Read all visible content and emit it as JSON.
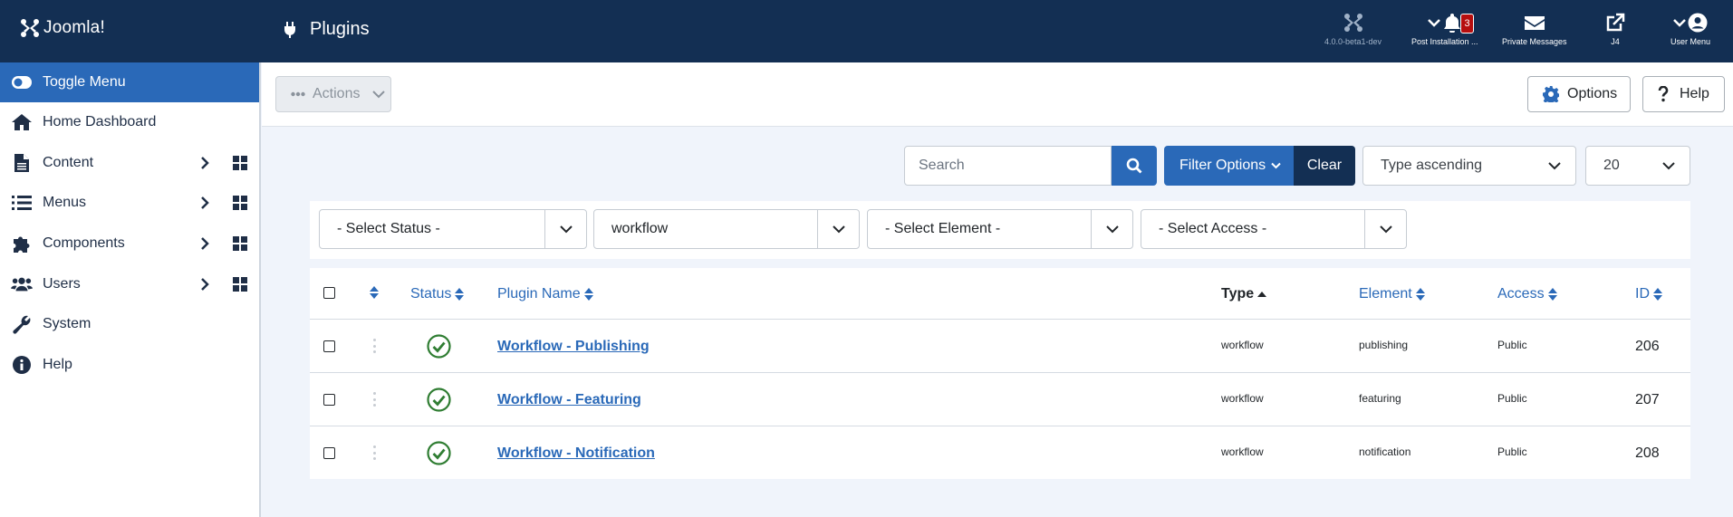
{
  "header": {
    "logo_text": "Joomla!",
    "title": "Plugins",
    "items": [
      {
        "label": "4.0.0-beta1-dev",
        "icon": "joomla-icon"
      },
      {
        "label": "Post Installation ...",
        "icon": "bell-icon",
        "badge": "3"
      },
      {
        "label": "Private Messages",
        "icon": "envelope-icon"
      },
      {
        "label": "J4",
        "icon": "external-link-icon"
      },
      {
        "label": "User Menu",
        "icon": "user-icon"
      }
    ]
  },
  "sidebar": {
    "items": [
      {
        "label": "Toggle Menu",
        "icon": "toggle-icon",
        "active": true
      },
      {
        "label": "Home Dashboard",
        "icon": "home-icon"
      },
      {
        "label": "Content",
        "icon": "file-icon",
        "submenu": true
      },
      {
        "label": "Menus",
        "icon": "list-icon",
        "submenu": true
      },
      {
        "label": "Components",
        "icon": "puzzle-icon",
        "submenu": true
      },
      {
        "label": "Users",
        "icon": "users-icon",
        "submenu": true
      },
      {
        "label": "System",
        "icon": "wrench-icon"
      },
      {
        "label": "Help",
        "icon": "info-icon"
      }
    ]
  },
  "toolbar": {
    "actions_label": "Actions",
    "options_label": "Options",
    "help_label": "Help"
  },
  "filters": {
    "search_placeholder": "Search",
    "filter_options_label": "Filter Options",
    "clear_label": "Clear",
    "sort_value": "Type ascending",
    "limit_value": "20",
    "status_value": "- Select Status -",
    "folder_value": "workflow",
    "element_value": "- Select Element -",
    "access_value": "- Select Access -"
  },
  "table": {
    "headers": {
      "status": "Status",
      "name": "Plugin Name",
      "type": "Type",
      "element": "Element",
      "access": "Access",
      "id": "ID"
    },
    "rows": [
      {
        "name": "Workflow - Publishing",
        "type": "workflow",
        "element": "publishing",
        "access": "Public",
        "id": "206",
        "status": "enabled"
      },
      {
        "name": "Workflow - Featuring",
        "type": "workflow",
        "element": "featuring",
        "access": "Public",
        "id": "207",
        "status": "enabled"
      },
      {
        "name": "Workflow - Notification",
        "type": "workflow",
        "element": "notification",
        "access": "Public",
        "id": "208",
        "status": "enabled"
      }
    ]
  },
  "colors": {
    "header_bg": "#132f53",
    "accent": "#2a69b8",
    "success": "#2f7d32",
    "badge": "#b60e0e"
  }
}
